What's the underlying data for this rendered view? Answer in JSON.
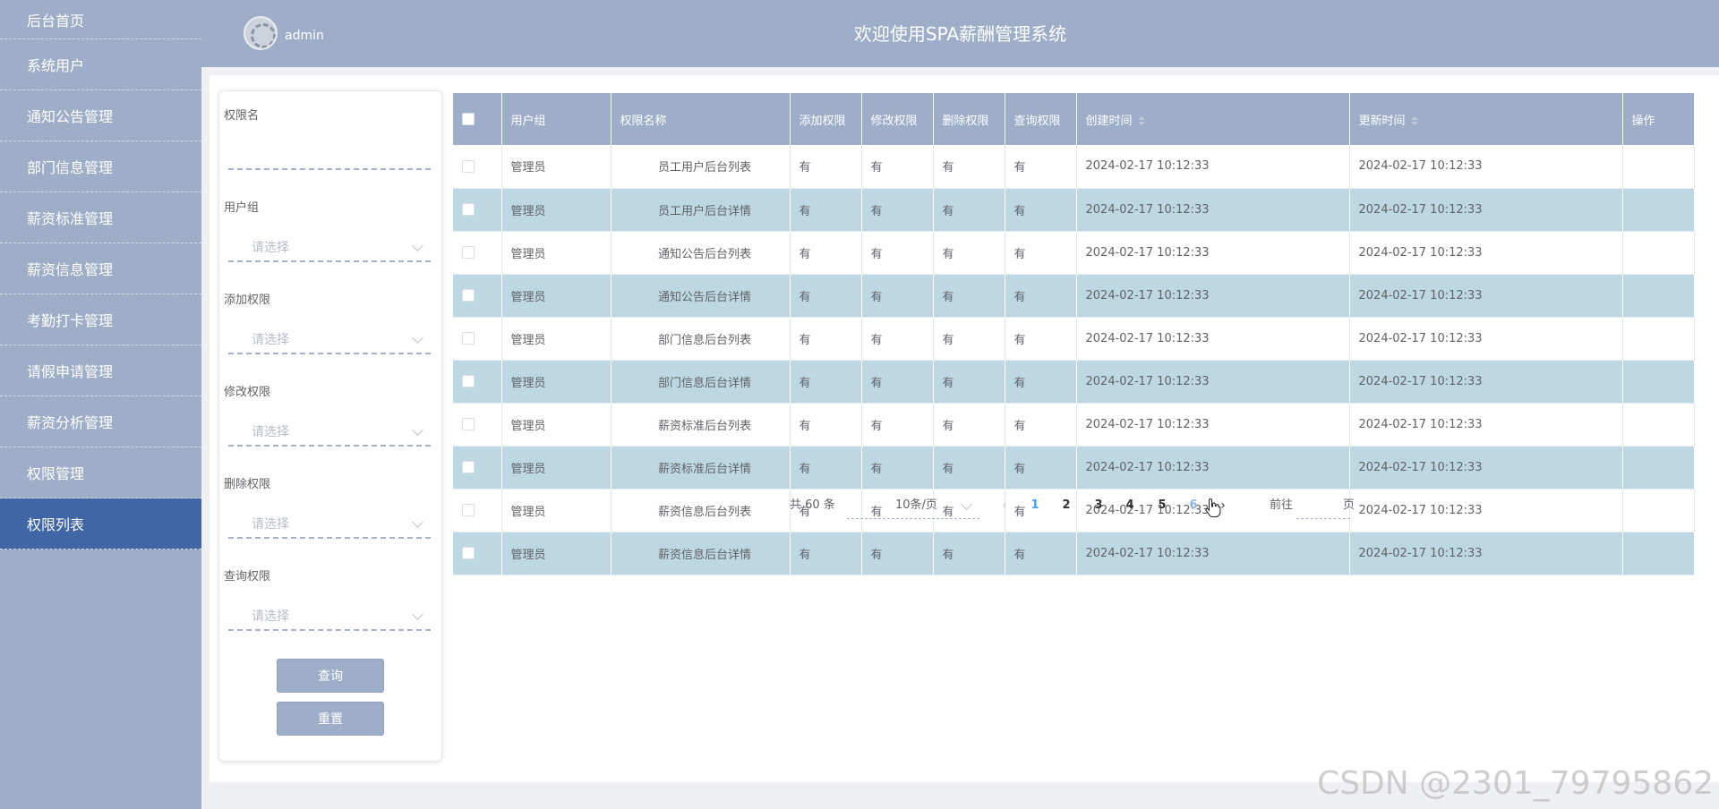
{
  "sidebar": {
    "items": [
      {
        "label": "后台首页"
      },
      {
        "label": "系统用户"
      },
      {
        "label": "通知公告管理"
      },
      {
        "label": "部门信息管理"
      },
      {
        "label": "薪资标准管理"
      },
      {
        "label": "薪资信息管理"
      },
      {
        "label": "考勤打卡管理"
      },
      {
        "label": "请假申请管理"
      },
      {
        "label": "薪资分析管理"
      },
      {
        "label": "权限管理"
      },
      {
        "label": "权限列表"
      }
    ],
    "active_index": 10
  },
  "header": {
    "user_name": "admin",
    "title": "欢迎使用SPA薪酬管理系统"
  },
  "search": {
    "perm_name_label": "权限名",
    "perm_name_value": "",
    "user_group_label": "用户组",
    "add_label": "添加权限",
    "edit_label": "修改权限",
    "delete_label": "删除权限",
    "query_label": "查询权限",
    "select_placeholder": "请选择",
    "query_button": "查询",
    "reset_button": "重置"
  },
  "table": {
    "headers": {
      "user_group": "用户组",
      "perm_name": "权限名称",
      "add": "添加权限",
      "edit": "修改权限",
      "delete": "删除权限",
      "query": "查询权限",
      "created": "创建时间",
      "updated": "更新时间",
      "action": "操作"
    },
    "rows": [
      {
        "user_group": "管理员",
        "perm_name": "员工用户后台列表",
        "add": "有",
        "edit": "有",
        "delete": "有",
        "query": "有",
        "created": "2024-02-17 10:12:33",
        "updated": "2024-02-17 10:12:33"
      },
      {
        "user_group": "管理员",
        "perm_name": "员工用户后台详情",
        "add": "有",
        "edit": "有",
        "delete": "有",
        "query": "有",
        "created": "2024-02-17 10:12:33",
        "updated": "2024-02-17 10:12:33"
      },
      {
        "user_group": "管理员",
        "perm_name": "通知公告后台列表",
        "add": "有",
        "edit": "有",
        "delete": "有",
        "query": "有",
        "created": "2024-02-17 10:12:33",
        "updated": "2024-02-17 10:12:33"
      },
      {
        "user_group": "管理员",
        "perm_name": "通知公告后台详情",
        "add": "有",
        "edit": "有",
        "delete": "有",
        "query": "有",
        "created": "2024-02-17 10:12:33",
        "updated": "2024-02-17 10:12:33"
      },
      {
        "user_group": "管理员",
        "perm_name": "部门信息后台列表",
        "add": "有",
        "edit": "有",
        "delete": "有",
        "query": "有",
        "created": "2024-02-17 10:12:33",
        "updated": "2024-02-17 10:12:33"
      },
      {
        "user_group": "管理员",
        "perm_name": "部门信息后台详情",
        "add": "有",
        "edit": "有",
        "delete": "有",
        "query": "有",
        "created": "2024-02-17 10:12:33",
        "updated": "2024-02-17 10:12:33"
      },
      {
        "user_group": "管理员",
        "perm_name": "薪资标准后台列表",
        "add": "有",
        "edit": "有",
        "delete": "有",
        "query": "有",
        "created": "2024-02-17 10:12:33",
        "updated": "2024-02-17 10:12:33"
      },
      {
        "user_group": "管理员",
        "perm_name": "薪资标准后台详情",
        "add": "有",
        "edit": "有",
        "delete": "有",
        "query": "有",
        "created": "2024-02-17 10:12:33",
        "updated": "2024-02-17 10:12:33"
      },
      {
        "user_group": "管理员",
        "perm_name": "薪资信息后台列表",
        "add": "有",
        "edit": "有",
        "delete": "有",
        "query": "有",
        "created": "2024-02-17 10:12:33",
        "updated": "2024-02-17 10:12:33"
      },
      {
        "user_group": "管理员",
        "perm_name": "薪资信息后台详情",
        "add": "有",
        "edit": "有",
        "delete": "有",
        "query": "有",
        "created": "2024-02-17 10:12:33",
        "updated": "2024-02-17 10:12:33"
      }
    ]
  },
  "pagination": {
    "total": "共 60 条",
    "page_size": "10条/页",
    "pages": [
      "1",
      "2",
      "3",
      "4",
      "5",
      "6"
    ],
    "current": "1",
    "goto_prefix": "前往",
    "goto_suffix": "页",
    "goto_value": ""
  },
  "watermark": "CSDN @2301_79795862",
  "colors": {
    "sidebar_bg": "#9eaec8",
    "active_item": "#4066a6",
    "row_stripe": "#bed8e3",
    "page_active": "#409eff"
  }
}
